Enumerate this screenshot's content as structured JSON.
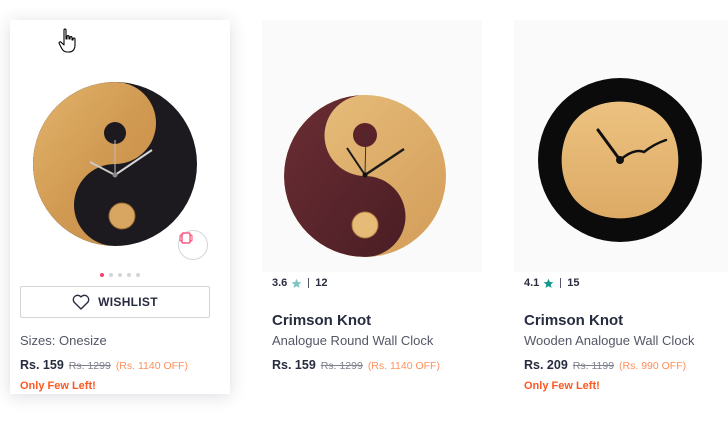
{
  "colors": {
    "accent": "#ff3f6c",
    "discount": "#ff905a",
    "stock_warning": "#ff5722",
    "star": "#14958f",
    "text_primary": "#282c3f",
    "text_secondary": "#535766"
  },
  "products": [
    {
      "image_icon": "yin-yang-wall-clock-wood-black",
      "carousel_dots": 5,
      "carousel_active_index": 0,
      "wishlist_label": "WISHLIST",
      "sizes_label": "Sizes: Onesize",
      "price": "Rs. 159",
      "mrp": "Rs. 1299",
      "discount": "(Rs. 1140 OFF)",
      "stock_label": "Only Few Left!"
    },
    {
      "image_icon": "yin-yang-wall-clock-maroon-wood",
      "rating": "3.6",
      "rating_count": "12",
      "brand": "Crimson Knot",
      "name": "Analogue Round Wall Clock",
      "price": "Rs. 159",
      "mrp": "Rs. 1299",
      "discount": "(Rs. 1140 OFF)"
    },
    {
      "image_icon": "wooden-square-clock-black-ring",
      "rating": "4.1",
      "rating_count": "15",
      "brand": "Crimson Knot",
      "name": "Wooden Analogue Wall Clock",
      "price": "Rs. 209",
      "mrp": "Rs. 1199",
      "discount": "(Rs. 990 OFF)",
      "stock_label": "Only Few Left!"
    }
  ]
}
